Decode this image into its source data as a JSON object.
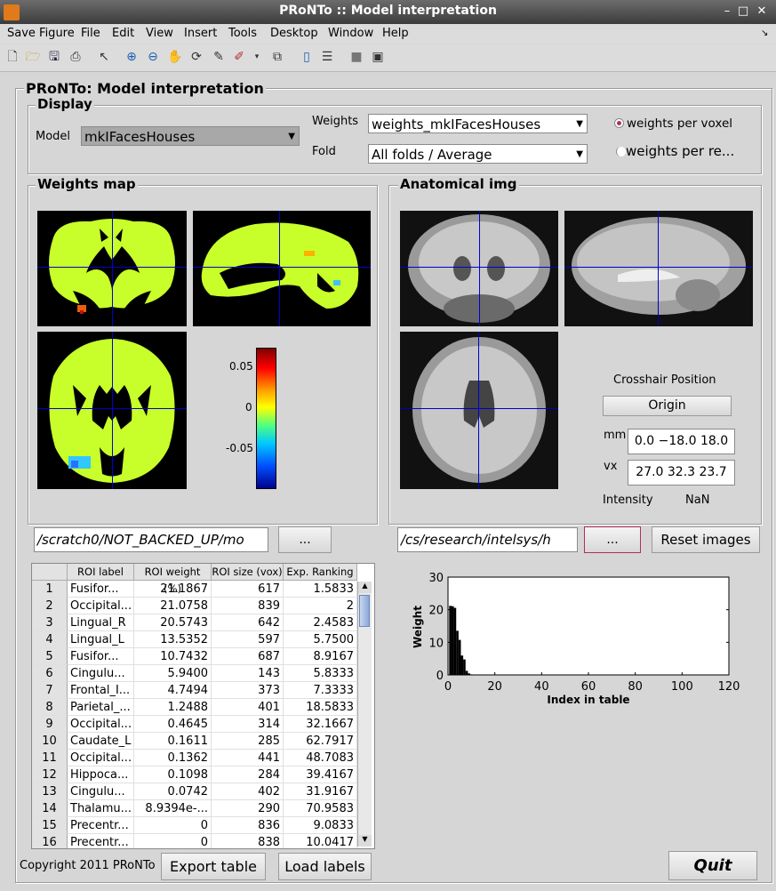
{
  "window": {
    "title": "PRoNTo :: Model interpretation",
    "buttons": [
      "–",
      "□",
      "✕"
    ]
  },
  "menu": [
    "Save Figure",
    "File",
    "Edit",
    "View",
    "Insert",
    "Tools",
    "Desktop",
    "Window",
    "Help"
  ],
  "figure_title": "PRoNTo: Model interpretation",
  "display": {
    "title": "Display",
    "model_label": "Model",
    "model_value": "mkIFacesHouses",
    "weights_label": "Weights",
    "weights_value": "weights_mkIFacesHouses",
    "fold_label": "Fold",
    "fold_value": "All folds / Average",
    "radio1": "weights per voxel",
    "radio2": "weights per re..."
  },
  "weights_map": {
    "title": "Weights map",
    "colorbar_ticks": [
      "0.05",
      "0",
      "-0.05"
    ]
  },
  "anatomical": {
    "title": "Anatomical img",
    "crosshair_title": "Crosshair Position",
    "origin_button": "Origin",
    "mm_label": "mm",
    "mm_value": "0.0 −18.0 18.0",
    "vx_label": "vx",
    "vx_value": "27.0 32.3 23.7",
    "intensity_label": "Intensity",
    "intensity_value": "NaN"
  },
  "paths": {
    "weights_path": "/scratch0/NOT_BACKED_UP/mo",
    "weights_browse": "...",
    "anat_path": "/cs/research/intelsys/h",
    "anat_browse": "...",
    "reset_button": "Reset images"
  },
  "table": {
    "headers": [
      "ROI label",
      "ROI weight (%)",
      "ROI size (vox)",
      "Exp. Ranking"
    ],
    "rows": [
      [
        "1",
        "Fusifor...",
        "21.1867",
        "617",
        "1.5833"
      ],
      [
        "2",
        "Occipital...",
        "21.0758",
        "839",
        "2"
      ],
      [
        "3",
        "Lingual_R",
        "20.5743",
        "642",
        "2.4583"
      ],
      [
        "4",
        "Lingual_L",
        "13.5352",
        "597",
        "5.7500"
      ],
      [
        "5",
        "Fusifor...",
        "10.7432",
        "687",
        "8.9167"
      ],
      [
        "6",
        "Cingulu...",
        "5.9400",
        "143",
        "5.8333"
      ],
      [
        "7",
        "Frontal_I...",
        "4.7494",
        "373",
        "7.3333"
      ],
      [
        "8",
        "Parietal_...",
        "1.2488",
        "401",
        "18.5833"
      ],
      [
        "9",
        "Occipital...",
        "0.4645",
        "314",
        "32.1667"
      ],
      [
        "10",
        "Caudate_L",
        "0.1611",
        "285",
        "62.7917"
      ],
      [
        "11",
        "Occipital...",
        "0.1362",
        "441",
        "48.7083"
      ],
      [
        "12",
        "Hippoca...",
        "0.1098",
        "284",
        "39.4167"
      ],
      [
        "13",
        "Cingulu...",
        "0.0742",
        "402",
        "31.9167"
      ],
      [
        "14",
        "Thalamu...",
        "8.9394e-...",
        "290",
        "70.9583"
      ],
      [
        "15",
        "Precentr...",
        "0",
        "836",
        "9.0833"
      ],
      [
        "16",
        "Precentr...",
        "0",
        "838",
        "10.0417"
      ]
    ]
  },
  "chart_data": {
    "type": "bar",
    "xlabel": "Index in table",
    "ylabel": "Weight",
    "xlim": [
      0,
      120
    ],
    "ylim": [
      0,
      30
    ],
    "xticks": [
      "0",
      "20",
      "40",
      "60",
      "80",
      "100",
      "120"
    ],
    "yticks": [
      "0",
      "10",
      "20",
      "30"
    ],
    "x": [
      1,
      2,
      3,
      4,
      5,
      6,
      7,
      8,
      9,
      10,
      11,
      12,
      13,
      14,
      15,
      16
    ],
    "values": [
      21.1867,
      21.0758,
      20.5743,
      13.5352,
      10.7432,
      5.94,
      4.7494,
      1.2488,
      0.4645,
      0.1611,
      0.1362,
      0.1098,
      0.0742,
      0.0893,
      0,
      0
    ]
  },
  "footer": {
    "copyright": "Copyright 2011 PRoNTo",
    "export_button": "Export table",
    "load_button": "Load labels",
    "quit_button": "Quit"
  }
}
